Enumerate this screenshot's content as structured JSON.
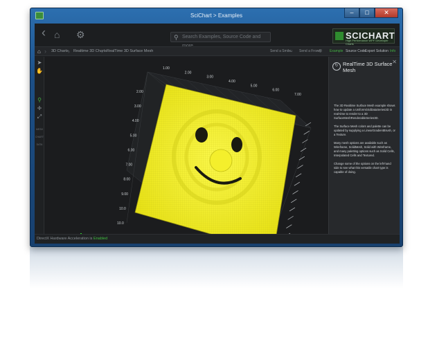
{
  "window": {
    "title": "SciChart > Examples",
    "buttons": [
      "–",
      "□",
      "✕"
    ]
  },
  "toolbar": {
    "back_icon": "‹",
    "home_icon": "⌂",
    "settings_icon": "⚙",
    "search_placeholder": "Search Examples, Source Code and more...",
    "logo_text": "SCICHART",
    "logo_subtext": "High Performance WPF Developer Charts"
  },
  "breadcrumb": {
    "items": [
      "3D Charts",
      "Realtime 3D Charts",
      "RealTime 3D Surface Mesh"
    ]
  },
  "actions": {
    "send_smile": "Send a Smile",
    "send_frown": "Send a Frown",
    "tabs": [
      "Example",
      "Source Code",
      "Export Solution",
      "Info"
    ],
    "active_tab": "Example"
  },
  "tools": {
    "labels": [
      "MESH",
      "CHART",
      "DATA"
    ]
  },
  "chart_data": {
    "type": "surface",
    "x_ticks": [
      "1.00",
      "2.00",
      "3.00",
      "4.00",
      "5.00",
      "6.00",
      "7.00",
      "8.00",
      "9.00",
      "10.0"
    ],
    "z_ticks": [
      "2.00",
      "3.00",
      "4.00",
      "5.00",
      "6.00",
      "7.00",
      "8.00",
      "9.00",
      "10.0",
      "10.0"
    ],
    "axis_labels": {
      "y": "Y",
      "z": "Z",
      "x": "X"
    },
    "corner_label": "10",
    "colors": {
      "surface": "#f7f22a",
      "wire": "#b9b50f",
      "axis_y": "#2fd12f",
      "axis_z": "#2f5fe0",
      "axis_x": "#e03030"
    }
  },
  "panel": {
    "title": "RealTime 3D Surface Mesh",
    "paragraphs": [
      "The 3D Realtime Surface Mesh example shows how to update a UniformGridDataSeries3D in real-time to render to a 3D SurfaceMeshRenderableSeries3D.",
      "The Surface Mesh colors and palette can be updated by supplying a LinearGradientBrush, or a Texture.",
      "Many mesh options are available such as Wireframe, SolidMesh, Solid with Wireframe, and many paletting options such as Solid Cells, Interpolated Cells and Textured.",
      "Change some of the options on the left-hand side to see what this versatile chart type is capable of doing."
    ]
  },
  "status": {
    "label": "DirectX Hardware Acceleration is",
    "value": "Enabled"
  }
}
